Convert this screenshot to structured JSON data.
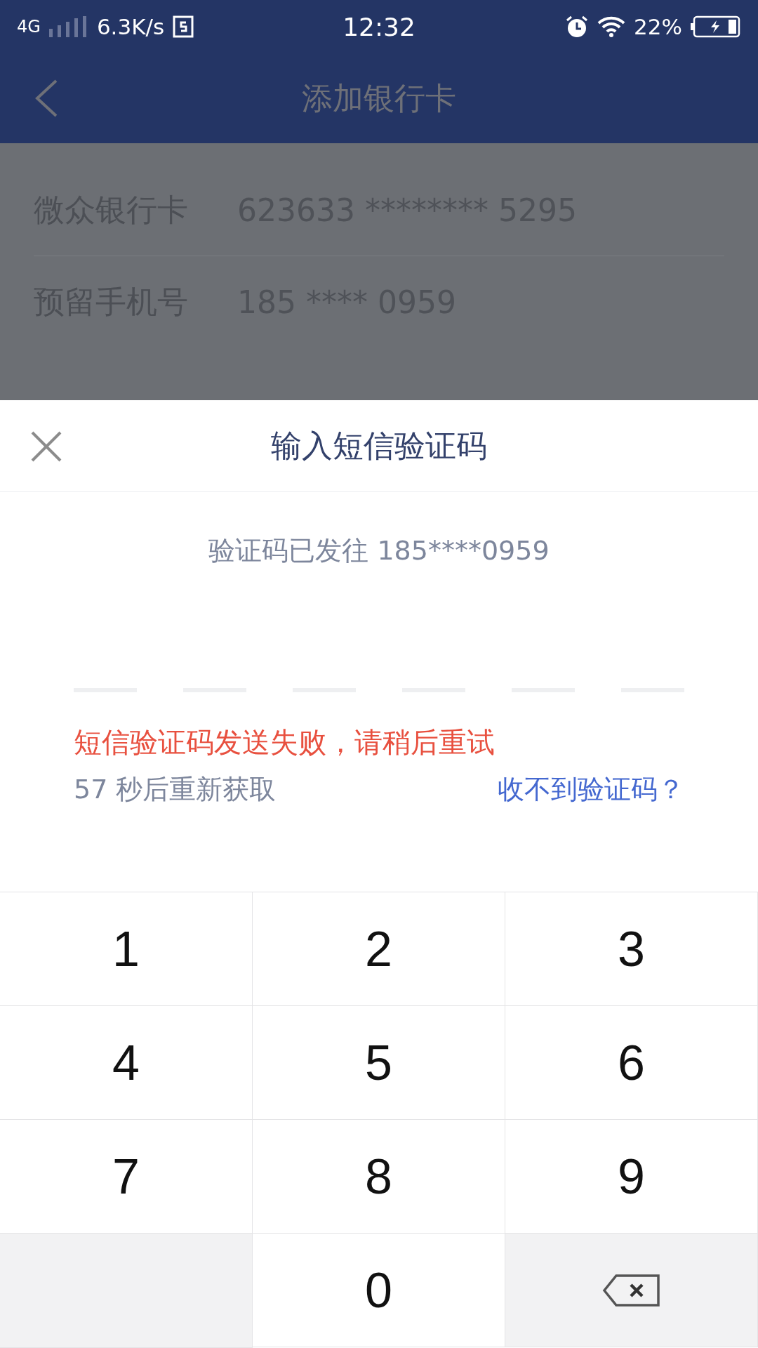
{
  "status_bar": {
    "network": "4G",
    "speed": "6.3K/s",
    "time": "12:32",
    "battery": "22%"
  },
  "header": {
    "title": "添加银行卡"
  },
  "card_form": [
    {
      "label": "微众银行卡",
      "value": "623633 ******** 5295"
    },
    {
      "label": "预留手机号",
      "value": "185 **** 0959"
    }
  ],
  "sms_sheet": {
    "title": "输入短信验证码",
    "sent_to": "验证码已发往 185****0959",
    "code_slots": [
      {
        "filled": false
      },
      {
        "filled": false
      },
      {
        "filled": false
      },
      {
        "filled": false
      },
      {
        "filled": false
      },
      {
        "filled": false
      }
    ],
    "error": "短信验证码发送失败，请稍后重试",
    "countdown": "57 秒后重新获取",
    "help_link": "收不到验证码？"
  },
  "keypad": [
    {
      "kind": "digit",
      "label": "1"
    },
    {
      "kind": "digit",
      "label": "2"
    },
    {
      "kind": "digit",
      "label": "3"
    },
    {
      "kind": "digit",
      "label": "4"
    },
    {
      "kind": "digit",
      "label": "5"
    },
    {
      "kind": "digit",
      "label": "6"
    },
    {
      "kind": "digit",
      "label": "7"
    },
    {
      "kind": "digit",
      "label": "8"
    },
    {
      "kind": "digit",
      "label": "9"
    },
    {
      "kind": "blank"
    },
    {
      "kind": "digit",
      "label": "0"
    },
    {
      "kind": "backspace"
    }
  ]
}
